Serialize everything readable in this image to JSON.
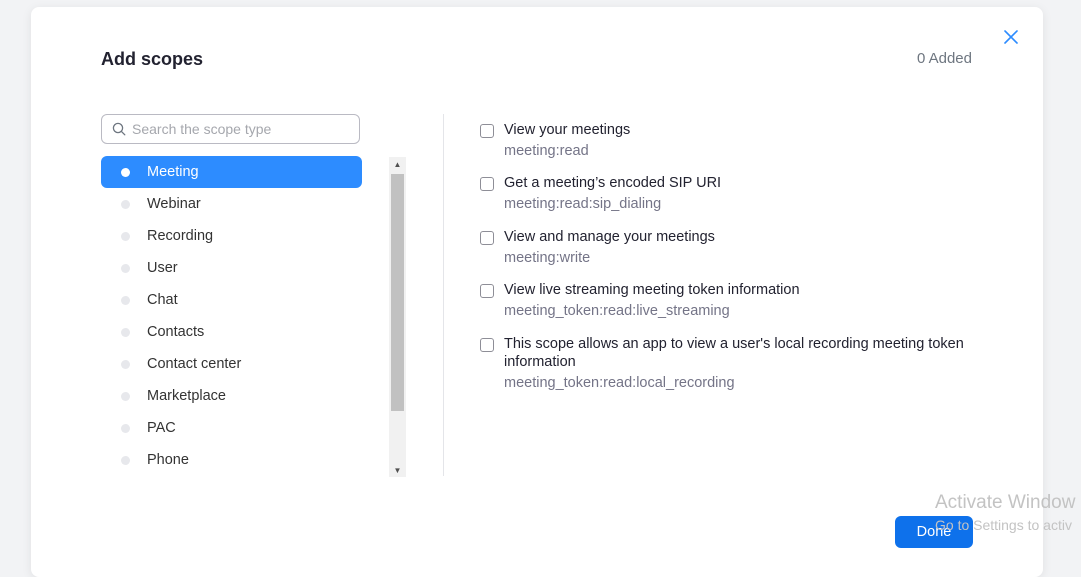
{
  "modal": {
    "title": "Add scopes",
    "added_count": "0 Added"
  },
  "search": {
    "placeholder": "Search the scope type"
  },
  "categories": [
    {
      "label": "Meeting",
      "active": true
    },
    {
      "label": "Webinar",
      "active": false
    },
    {
      "label": "Recording",
      "active": false
    },
    {
      "label": "User",
      "active": false
    },
    {
      "label": "Chat",
      "active": false
    },
    {
      "label": "Contacts",
      "active": false
    },
    {
      "label": "Contact center",
      "active": false
    },
    {
      "label": "Marketplace",
      "active": false
    },
    {
      "label": "PAC",
      "active": false
    },
    {
      "label": "Phone",
      "active": false
    }
  ],
  "scopes": [
    {
      "label": "View your meetings",
      "key": "meeting:read",
      "checked": false
    },
    {
      "label": "Get a meeting’s encoded SIP URI",
      "key": "meeting:read:sip_dialing",
      "checked": false
    },
    {
      "label": "View and manage your meetings",
      "key": "meeting:write",
      "checked": false
    },
    {
      "label": "View live streaming meeting token information",
      "key": "meeting_token:read:live_streaming",
      "checked": false
    },
    {
      "label": "This scope allows an app to view a user's local recording meeting token information",
      "key": "meeting_token:read:local_recording",
      "checked": false
    }
  ],
  "footer": {
    "done_label": "Done"
  },
  "watermark": {
    "line1": "Activate Window",
    "line2": "Go to Settings to activ"
  },
  "colors": {
    "accent": "#2d8cff",
    "done_button": "#0e71eb"
  },
  "icons": {
    "close": "close-icon",
    "search": "search-icon",
    "scroll_up": "scroll-up-arrow-icon",
    "scroll_down": "scroll-down-arrow-icon"
  }
}
